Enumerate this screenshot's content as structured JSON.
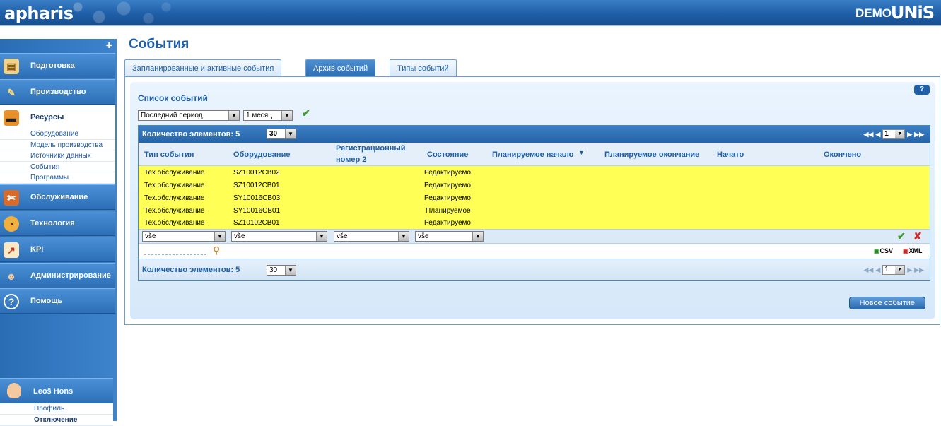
{
  "header": {
    "logo": "apharis",
    "demo": "DEMO",
    "brand": "UNIS"
  },
  "sidebar": {
    "pin_icon": "pin-icon",
    "items": [
      {
        "label": "Подготовка",
        "icon": "book-icon"
      },
      {
        "label": "Производство",
        "icon": "tools-icon"
      },
      {
        "label": "Ресурсы",
        "icon": "truck-icon"
      },
      {
        "label": "Обслуживание",
        "icon": "wrench-icon"
      },
      {
        "label": "Технология",
        "icon": "gauge-icon"
      },
      {
        "label": "KPI",
        "icon": "chart-icon"
      },
      {
        "label": "Администрирование",
        "icon": "users-icon"
      },
      {
        "label": "Помощь",
        "icon": "help-icon"
      }
    ],
    "subitems": [
      "Оборудование",
      "Модель производства",
      "Источники данных",
      "События",
      "Программы"
    ],
    "user": {
      "name": "Leoš Hons",
      "links": [
        "Профиль",
        "Отключение"
      ]
    }
  },
  "page": {
    "title": "События",
    "tabs": [
      "Запланированные и активные события",
      "Архив событий",
      "Типы событий"
    ],
    "active_tab": 1,
    "list_title": "Список событий",
    "help": "?",
    "period_select": "Последний период",
    "duration_select": "1 месяц",
    "count_label": "Количество элементов: 5",
    "per_page": "30",
    "page_number": "1",
    "new_button": "Новое событие",
    "export_csv": "CSV",
    "export_xml": "XML"
  },
  "table": {
    "columns": [
      "Тип события",
      "Оборудование",
      "Регистрационный",
      "номер 2",
      "Состояние",
      "Планируемое начало",
      "Планируемое окончание",
      "Начато",
      "Окончено"
    ],
    "sort_indicator": "▼",
    "rows": [
      [
        "Тех.обслуживание",
        "SZ10012CB02",
        "Редактируемо"
      ],
      [
        "Тех.обслуживание",
        "SZ10012CB01",
        "Редактируемо"
      ],
      [
        "Тех.обслуживание",
        "SY10016CB03",
        "Редактируемо"
      ],
      [
        "Тех.обслуживание",
        "SY10016CB01",
        "Планируемое"
      ],
      [
        "Тех.обслуживание",
        "SZ10102CB01",
        "Редактируемо"
      ]
    ],
    "filter_value": "vše"
  },
  "colors": {
    "accent": "#1f5fa8",
    "row_highlight": "#ffff55",
    "sidebar": "#2a6db5"
  }
}
